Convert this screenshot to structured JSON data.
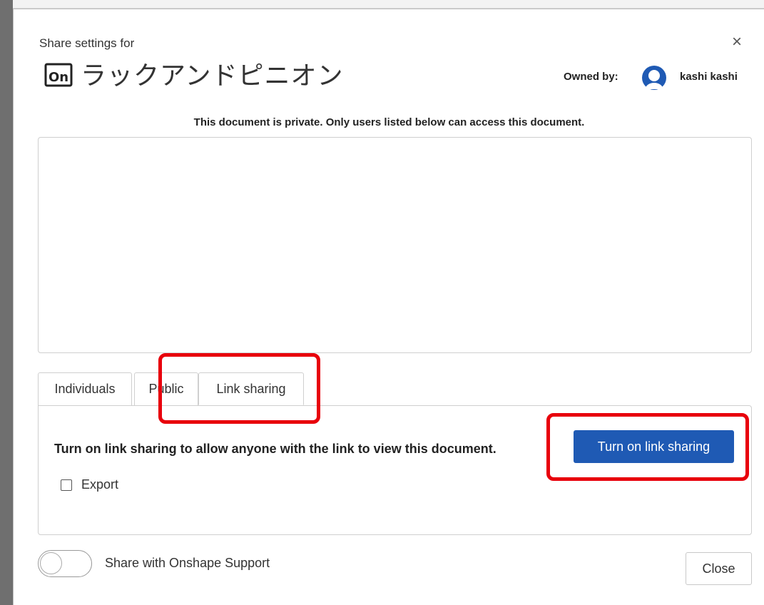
{
  "dialog": {
    "header_label": "Share settings for",
    "document_name": "ラックアンドピニオン",
    "owned_by_label": "Owned by:",
    "owner_name": "kashi kashi",
    "close_icon_glyph": "×",
    "doc_icon_text": "On",
    "private_message": "This document is private. Only users listed below can access this document."
  },
  "tabs": [
    {
      "label": "Individuals"
    },
    {
      "label": "Public"
    },
    {
      "label": "Link sharing",
      "active": true
    }
  ],
  "link_sharing": {
    "message": "Turn on link sharing to allow anyone with the link to view this document.",
    "button_label": "Turn on link sharing",
    "export_label": "Export",
    "export_checked": false
  },
  "footer": {
    "support_label": "Share with Onshape Support",
    "support_enabled": false,
    "close_label": "Close"
  },
  "colors": {
    "primary_button": "#1f5ab4",
    "highlight": "#e8000b",
    "border": "#cfcfcf"
  },
  "icons": {
    "doc": "onshape-doc-icon",
    "avatar": "user-avatar-icon",
    "close": "close-icon"
  }
}
